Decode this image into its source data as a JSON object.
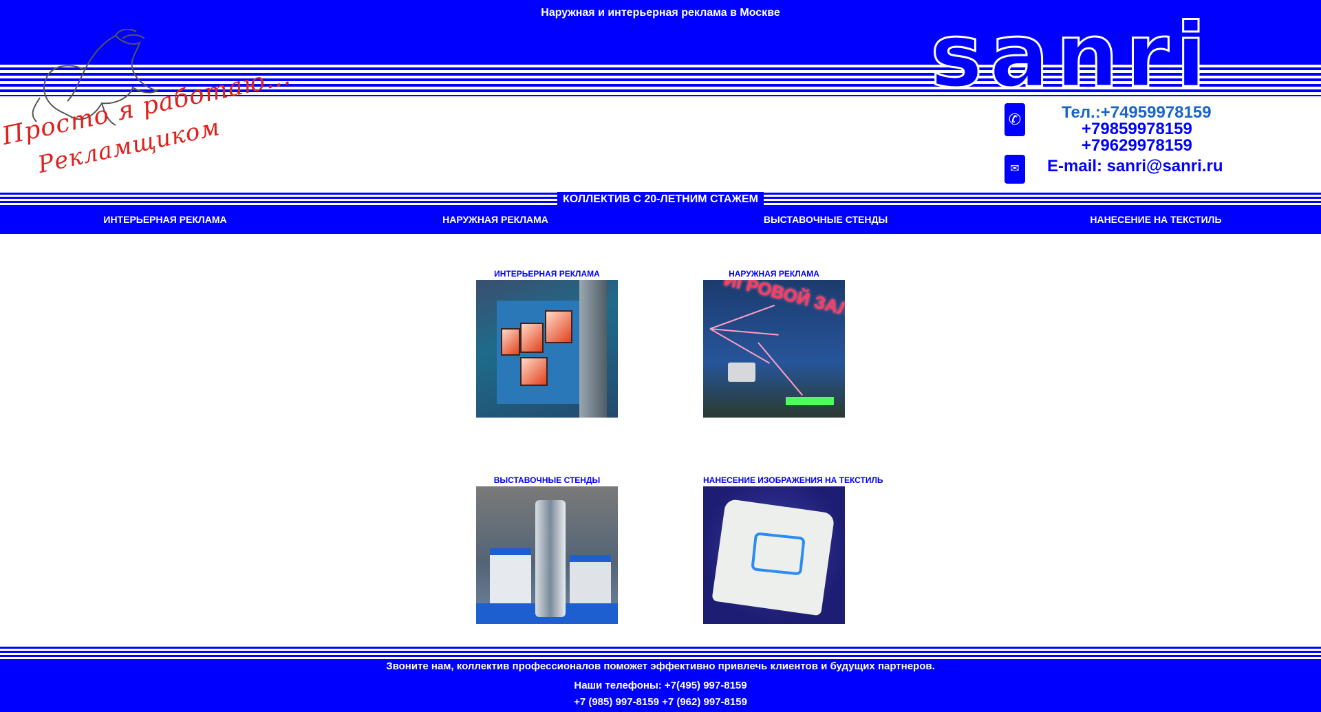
{
  "header": {
    "tagline": "Наружная и интерьерная реклама в Москве",
    "slogan_line1": "Просто я работаю...",
    "slogan_line2": "Рекламщиком",
    "brand": "sanri",
    "phone_icon": "phone-icon",
    "mail_icon": "mail-icon",
    "tel_line": "Тел.:+74959978159",
    "tel2": "+79859978159",
    "tel3": "+79629978159",
    "email_line": "E-mail: sanri@sanri.ru",
    "experience_label": "КОЛЛЕКТИВ С 20-ЛЕТНИМ СТАЖЕМ"
  },
  "nav": {
    "items": [
      {
        "label": "ИНТЕРЬЕРНАЯ РЕКЛАМА"
      },
      {
        "label": "НАРУЖНАЯ РЕКЛАМА"
      },
      {
        "label": "ВЫСТАВОЧНЫЕ СТЕНДЫ"
      },
      {
        "label": "НАНЕСЕНИЕ НА ТЕКСТИЛЬ"
      }
    ]
  },
  "catalog": {
    "items": [
      {
        "title": "ИНТЕРЬЕРНАЯ РЕКЛАМА"
      },
      {
        "title": "НАРУЖНАЯ РЕКЛАМА",
        "sign": "ИГРОВОЙ ЗАЛ"
      },
      {
        "title": "ВЫСТАВОЧНЫЕ СТЕНДЫ"
      },
      {
        "title": "НАНЕСЕНИЕ ИЗОБРАЖЕНИЯ НА ТЕКСТИЛЬ"
      }
    ]
  },
  "footer": {
    "promo": "Звоните нам, коллектив профессионалов поможет эффективно привлечь клиентов и будущих партнеров.",
    "phones_line1": "Наши телефоны: +7(495) 997-8159",
    "phones_line2": "+7 (985) 997-8159 +7 (962) 997-8159"
  },
  "colors": {
    "primary": "#0000ff",
    "slogan": "#e0201c",
    "tel_accent": "#1b64c8"
  }
}
